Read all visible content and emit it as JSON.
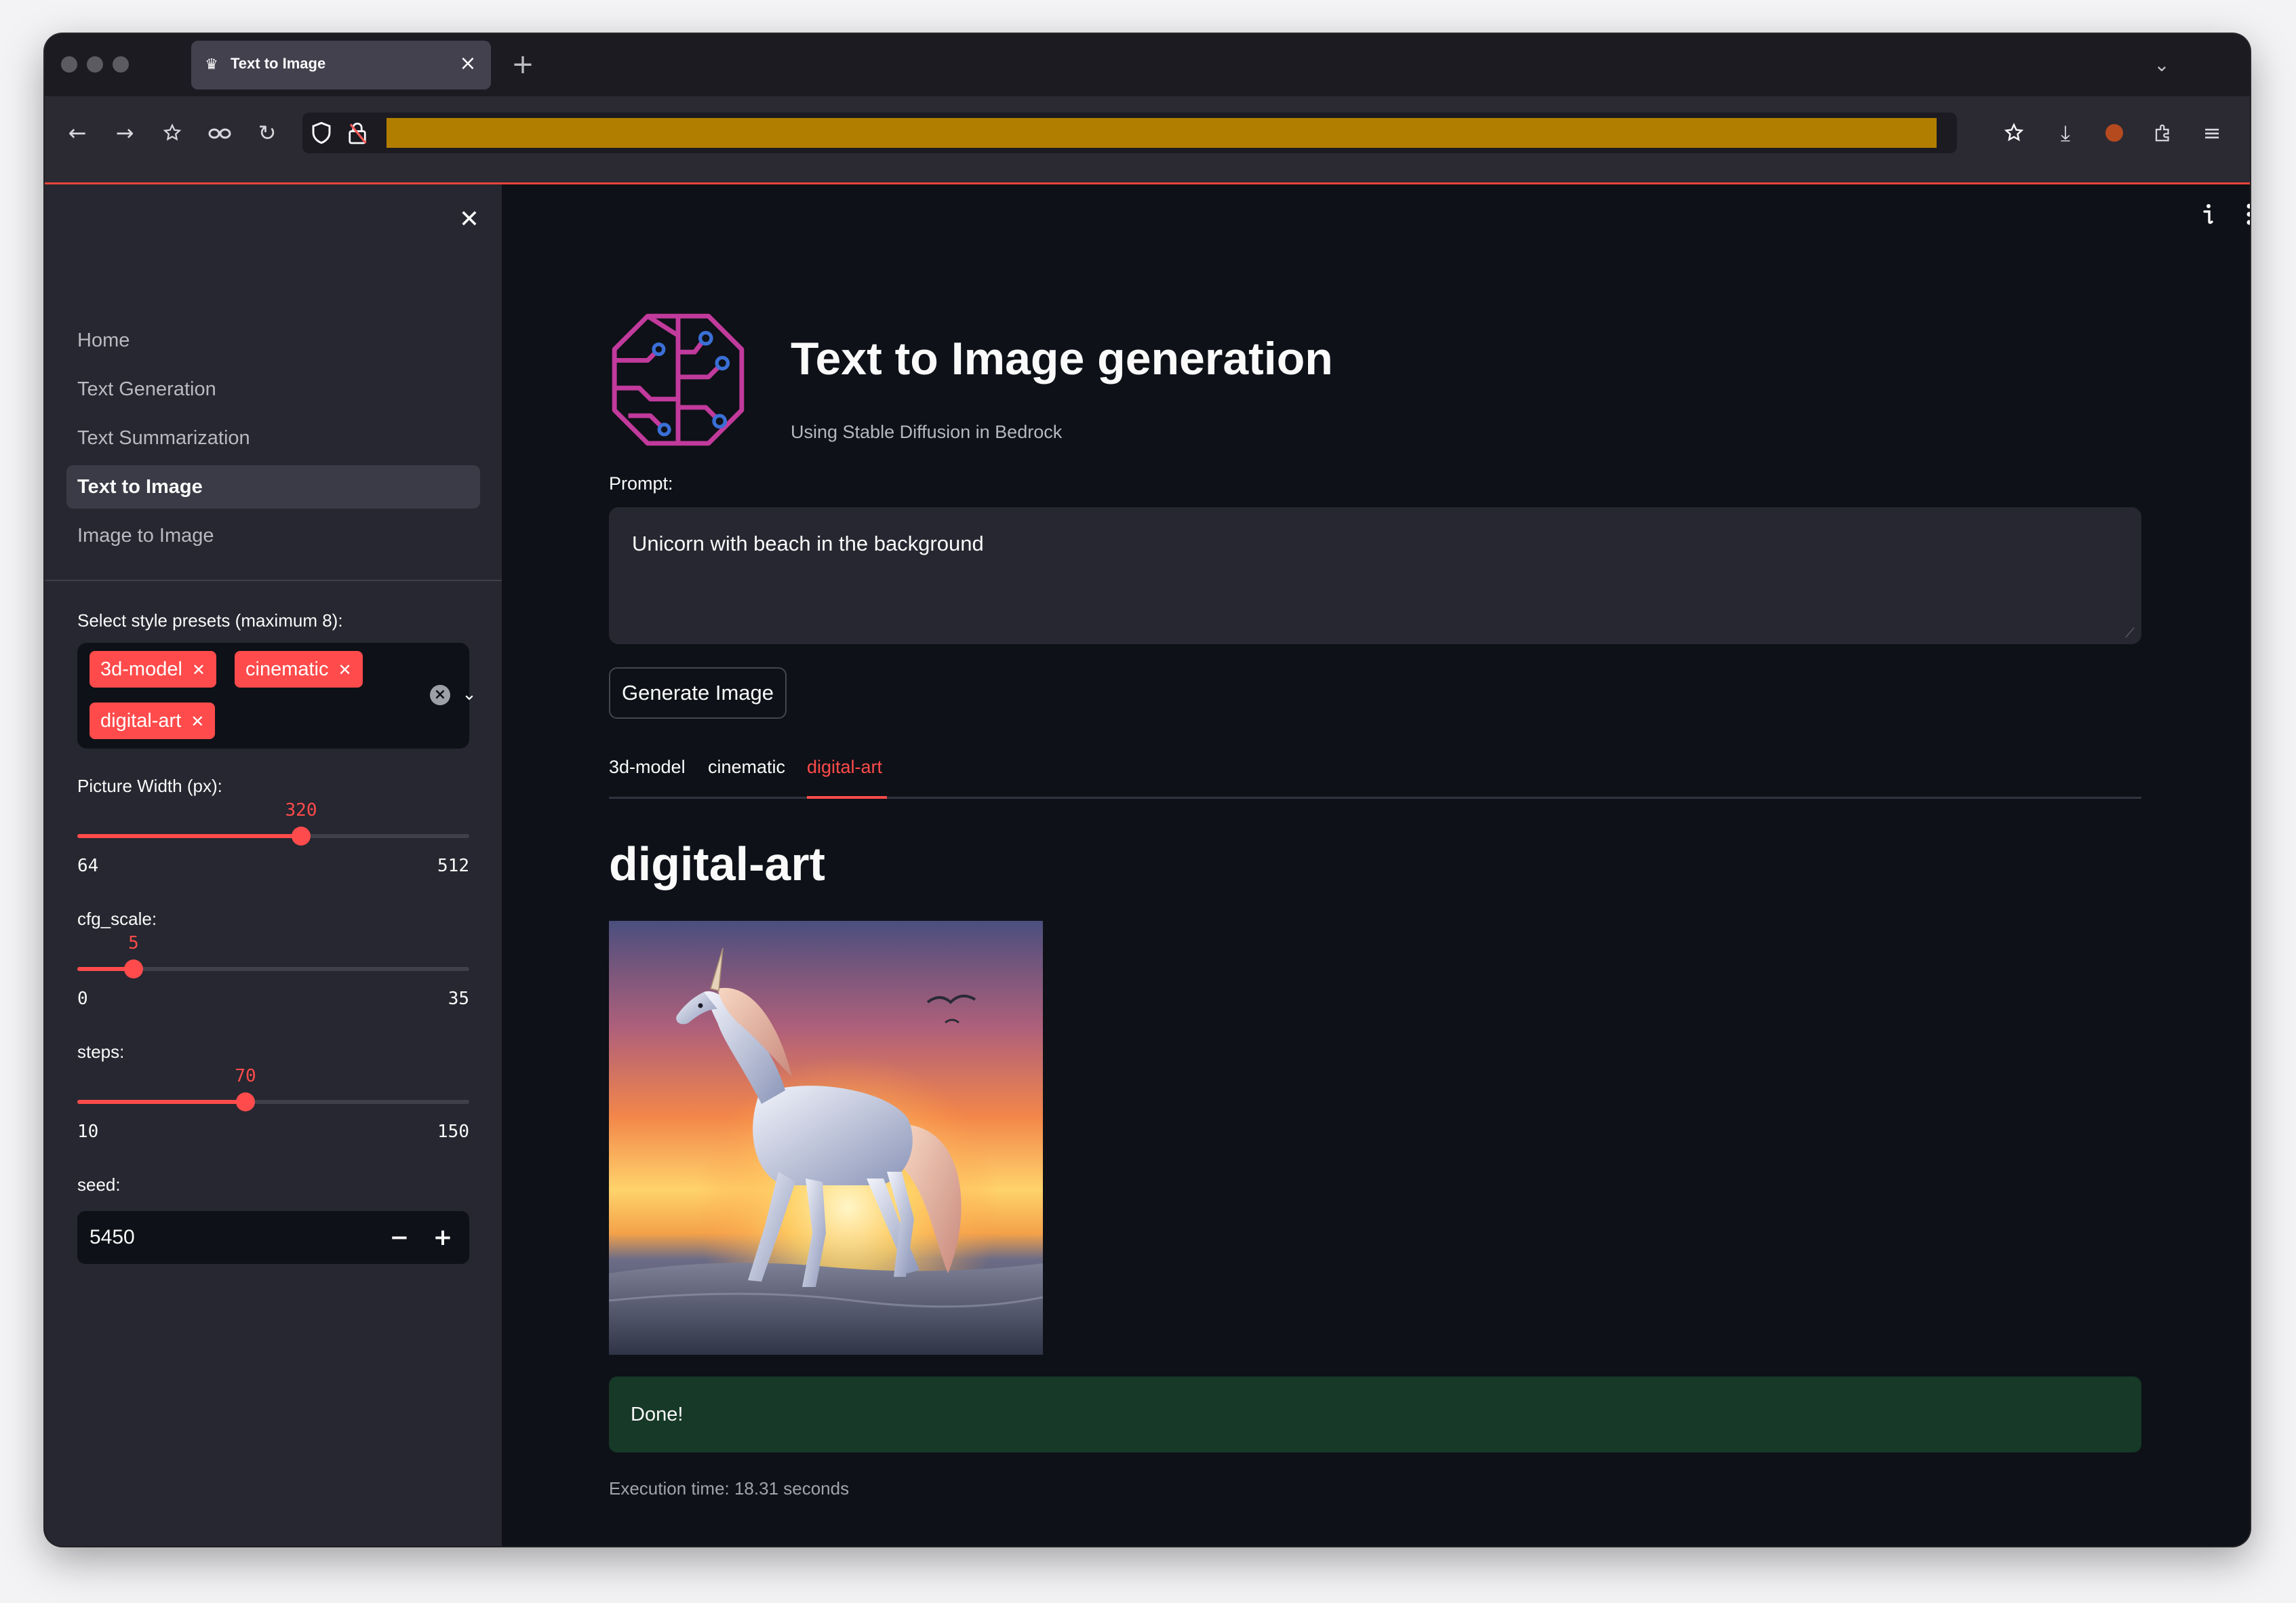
{
  "browser": {
    "tab_title": "Text to Image",
    "url_redacted": true
  },
  "sidebar": {
    "nav": [
      {
        "label": "Home",
        "active": false
      },
      {
        "label": "Text Generation",
        "active": false
      },
      {
        "label": "Text Summarization",
        "active": false
      },
      {
        "label": "Text to Image",
        "active": true
      },
      {
        "label": "Image to Image",
        "active": false
      }
    ],
    "style_presets": {
      "label": "Select style presets (maximum 8):",
      "selected": [
        "3d-model",
        "cinematic",
        "digital-art"
      ]
    },
    "width_slider": {
      "label": "Picture Width (px):",
      "value": "320",
      "min": "64",
      "max": "512",
      "fraction": 0.571
    },
    "cfg_slider": {
      "label": "cfg_scale:",
      "value": "5",
      "min": "0",
      "max": "35",
      "fraction": 0.143
    },
    "steps_slider": {
      "label": "steps:",
      "value": "70",
      "min": "10",
      "max": "150",
      "fraction": 0.429
    },
    "seed": {
      "label": "seed:",
      "value": "5450"
    }
  },
  "main": {
    "title": "Text to Image generation",
    "subtitle": "Using Stable Diffusion in Bedrock",
    "prompt_label": "Prompt:",
    "prompt_value": "Unicorn with beach in the background",
    "generate_button": "Generate Image",
    "tabs": [
      {
        "label": "3d-model",
        "active": false
      },
      {
        "label": "cinematic",
        "active": false
      },
      {
        "label": "digital-art",
        "active": true
      }
    ],
    "section_title": "digital-art",
    "status_message": "Done!",
    "execution_time": "Execution time: 18.31 seconds"
  },
  "colors": {
    "accent": "#ff4b4b",
    "sidebar_bg": "#262730",
    "main_bg": "#0e1117",
    "success_bg": "#173928",
    "logo": "#c13a9c"
  }
}
